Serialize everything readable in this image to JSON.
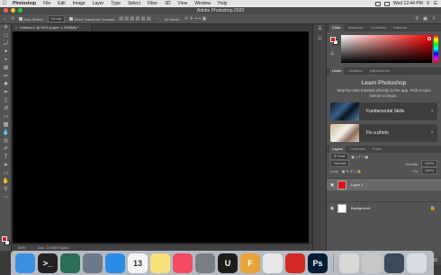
{
  "menubar": {
    "app": "Photoshop",
    "items": [
      "File",
      "Edit",
      "Image",
      "Layer",
      "Type",
      "Select",
      "Filter",
      "3D",
      "View",
      "Window",
      "Help"
    ],
    "time": "Wed 12:44 PM"
  },
  "window": {
    "title": "Adobe Photoshop 2020"
  },
  "options": {
    "auto_select_label": "Auto-Select:",
    "auto_select_value": "Group",
    "transform_label": "Show Transform Controls",
    "mode_3d": "3D Mode:"
  },
  "document": {
    "tab": "Untitled-1 @ 50% (Layer 1, RGB/8) *",
    "zoom": "50%",
    "doc_size": "Doc: 24.9M/0 bytes"
  },
  "color_panel": {
    "tabs": [
      "Color",
      "Swatches",
      "Gradients",
      "Patterns"
    ],
    "foreground": "#e8141c",
    "background": "#ffffff"
  },
  "learn_panel": {
    "tabs": [
      "Learn",
      "Libraries",
      "Adjustments"
    ],
    "title": "Learn Photoshop",
    "description": "Step-by-step tutorials directly in the app. Pick a topic below to begin.",
    "cards": [
      "Fundamental Skills",
      "Fix a photo"
    ]
  },
  "layers_panel": {
    "tabs": [
      "Layers",
      "Channels",
      "Paths"
    ],
    "kind": "Kind",
    "blend_mode": "Normal",
    "opacity_label": "Opacity:",
    "opacity_value": "100%",
    "lock_label": "Lock:",
    "fill_label": "Fill:",
    "fill_value": "100%",
    "layers": [
      {
        "name": "Layer 1",
        "color": "#d8141c"
      },
      {
        "name": "Background",
        "color": "#ffffff"
      }
    ]
  },
  "dock": {
    "apps": [
      {
        "icon": "finder-icon",
        "color": "#3b8fe0",
        "label": ""
      },
      {
        "icon": "terminal-icon",
        "color": "#222222",
        "label": ">_"
      },
      {
        "icon": "time-machine-icon",
        "color": "#2c6e5a",
        "label": ""
      },
      {
        "icon": "launchpad-icon",
        "color": "#6d7a8a",
        "label": ""
      },
      {
        "icon": "safari-icon",
        "color": "#2b8de8",
        "label": ""
      },
      {
        "icon": "calendar-icon",
        "color": "#f4f4f4",
        "label": "13"
      },
      {
        "icon": "notes-icon",
        "color": "#f7e27a",
        "label": ""
      },
      {
        "icon": "music-icon",
        "color": "#f34b63",
        "label": ""
      },
      {
        "icon": "system-preferences-icon",
        "color": "#7a7f86",
        "label": ""
      },
      {
        "icon": "unreal-engine-icon",
        "color": "#1d1d1d",
        "label": "U"
      },
      {
        "icon": "font-app-icon",
        "color": "#e8a23a",
        "label": "F"
      },
      {
        "icon": "chrome-icon",
        "color": "#e8e8e8",
        "label": ""
      },
      {
        "icon": "creative-cloud-icon",
        "color": "#d42a27",
        "label": ""
      },
      {
        "icon": "photoshop-icon",
        "color": "#001e36",
        "label": "Ps"
      },
      {
        "icon": "preview-icon",
        "color": "#d8d8d8",
        "label": ""
      },
      {
        "icon": "photo-app-icon",
        "color": "#c7c7c7",
        "label": ""
      },
      {
        "icon": "display-icon",
        "color": "#3b4a5a",
        "label": ""
      },
      {
        "icon": "trash-icon",
        "color": "#d9dde2",
        "label": ""
      }
    ]
  }
}
